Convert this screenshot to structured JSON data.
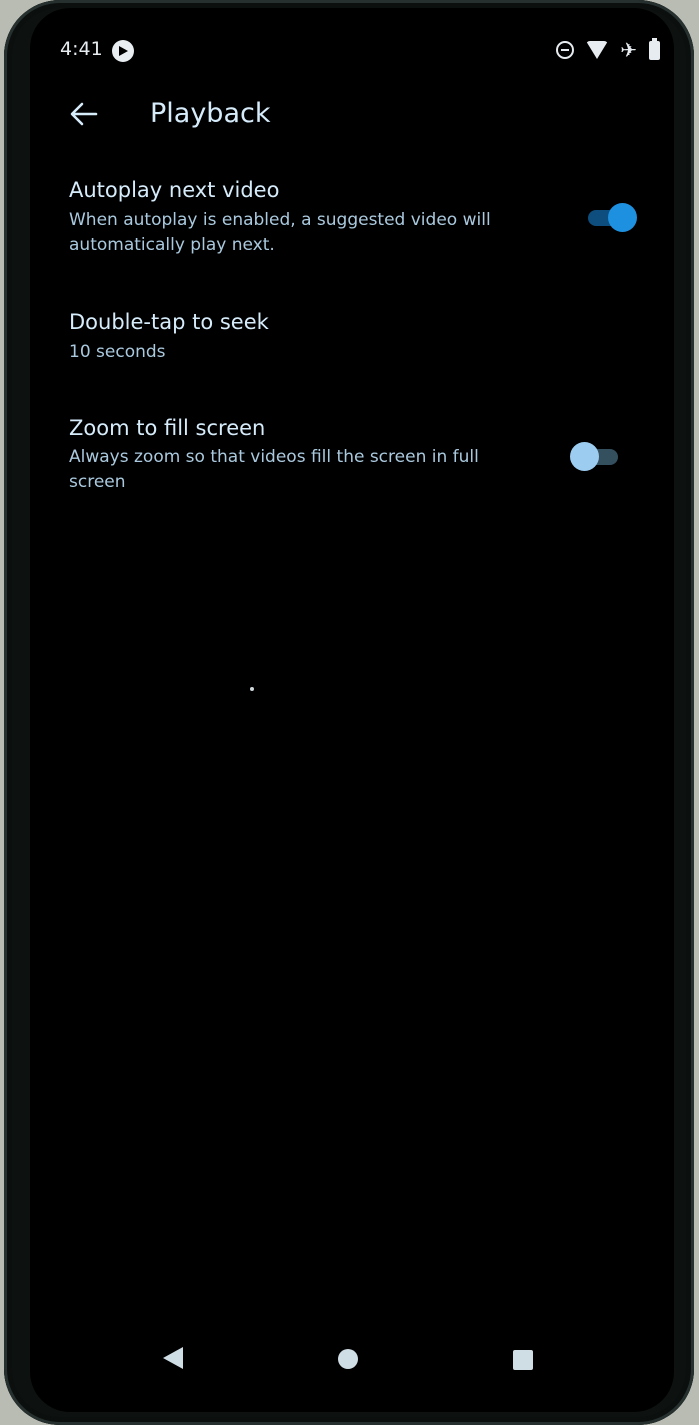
{
  "status_bar": {
    "time": "4:41",
    "icons": [
      "media-app-icon",
      "do-not-disturb-icon",
      "wifi-icon",
      "airplane-icon",
      "battery-icon"
    ]
  },
  "app_bar": {
    "title": "Playback",
    "back_icon": "arrow-left-icon"
  },
  "settings": [
    {
      "title": "Autoplay next video",
      "summary": "When autoplay is enabled, a suggested video will automatically play next.",
      "toggle": true
    },
    {
      "title": "Double-tap to seek",
      "summary": "10 seconds"
    },
    {
      "title": "Zoom to fill screen",
      "summary": "Always zoom so that videos fill the screen in full screen",
      "toggle": false
    }
  ],
  "nav_bar": {
    "icons": [
      "nav-back-icon",
      "nav-home-icon",
      "nav-recents-icon"
    ]
  },
  "colors": {
    "background": "#000000",
    "title_text": "#d6ecfb",
    "summary_text": "#aac9de",
    "accent": "#1e90e0"
  }
}
